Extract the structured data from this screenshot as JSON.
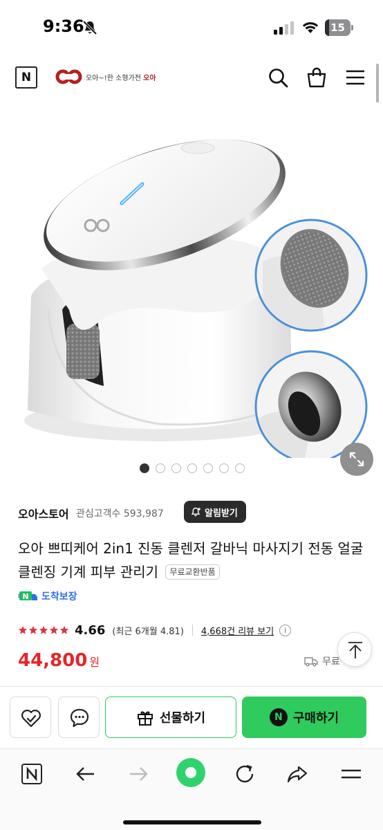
{
  "status_bar": {
    "time": "9:36",
    "battery": "15",
    "battery_level": 0.15
  },
  "header": {
    "brand_slogan_prefix": "오아~!한 소형가전",
    "brand_slogan_name": "오아",
    "icons": [
      "naver-n-icon",
      "search-icon",
      "shopping-bag-icon",
      "menu-icon"
    ]
  },
  "gallery": {
    "total_images": 7,
    "active_index": 0
  },
  "store": {
    "name": "오아스토어",
    "fans_label": "관심고객수",
    "fans_count": "593,987",
    "notify_label": "알림받기"
  },
  "product": {
    "title": "오아 쁘띠케어 2in1 진동 클렌저 갈바닉 마사지기 전동 얼굴 클렌징 기계 피부 관리기",
    "chip": "무료교환반품",
    "delivery_badge": "도착보장",
    "rating": 5,
    "rating_value": "4.66",
    "recent_rating": "(최근 6개월 4.81)",
    "reviews_link": "4,668건 리뷰 보기",
    "info": "i",
    "price": "44,800",
    "currency": "원",
    "shipping": "무료"
  },
  "actions": {
    "gift_label": "선물하기",
    "buy_label": "구매하기",
    "buy_badge": "N"
  },
  "colors": {
    "accent_green": "#2fcb5d",
    "price_red": "#e52528",
    "star_red": "#d9364a",
    "brand_red": "#b32121",
    "delivery_blue": "#2f6fe8"
  }
}
